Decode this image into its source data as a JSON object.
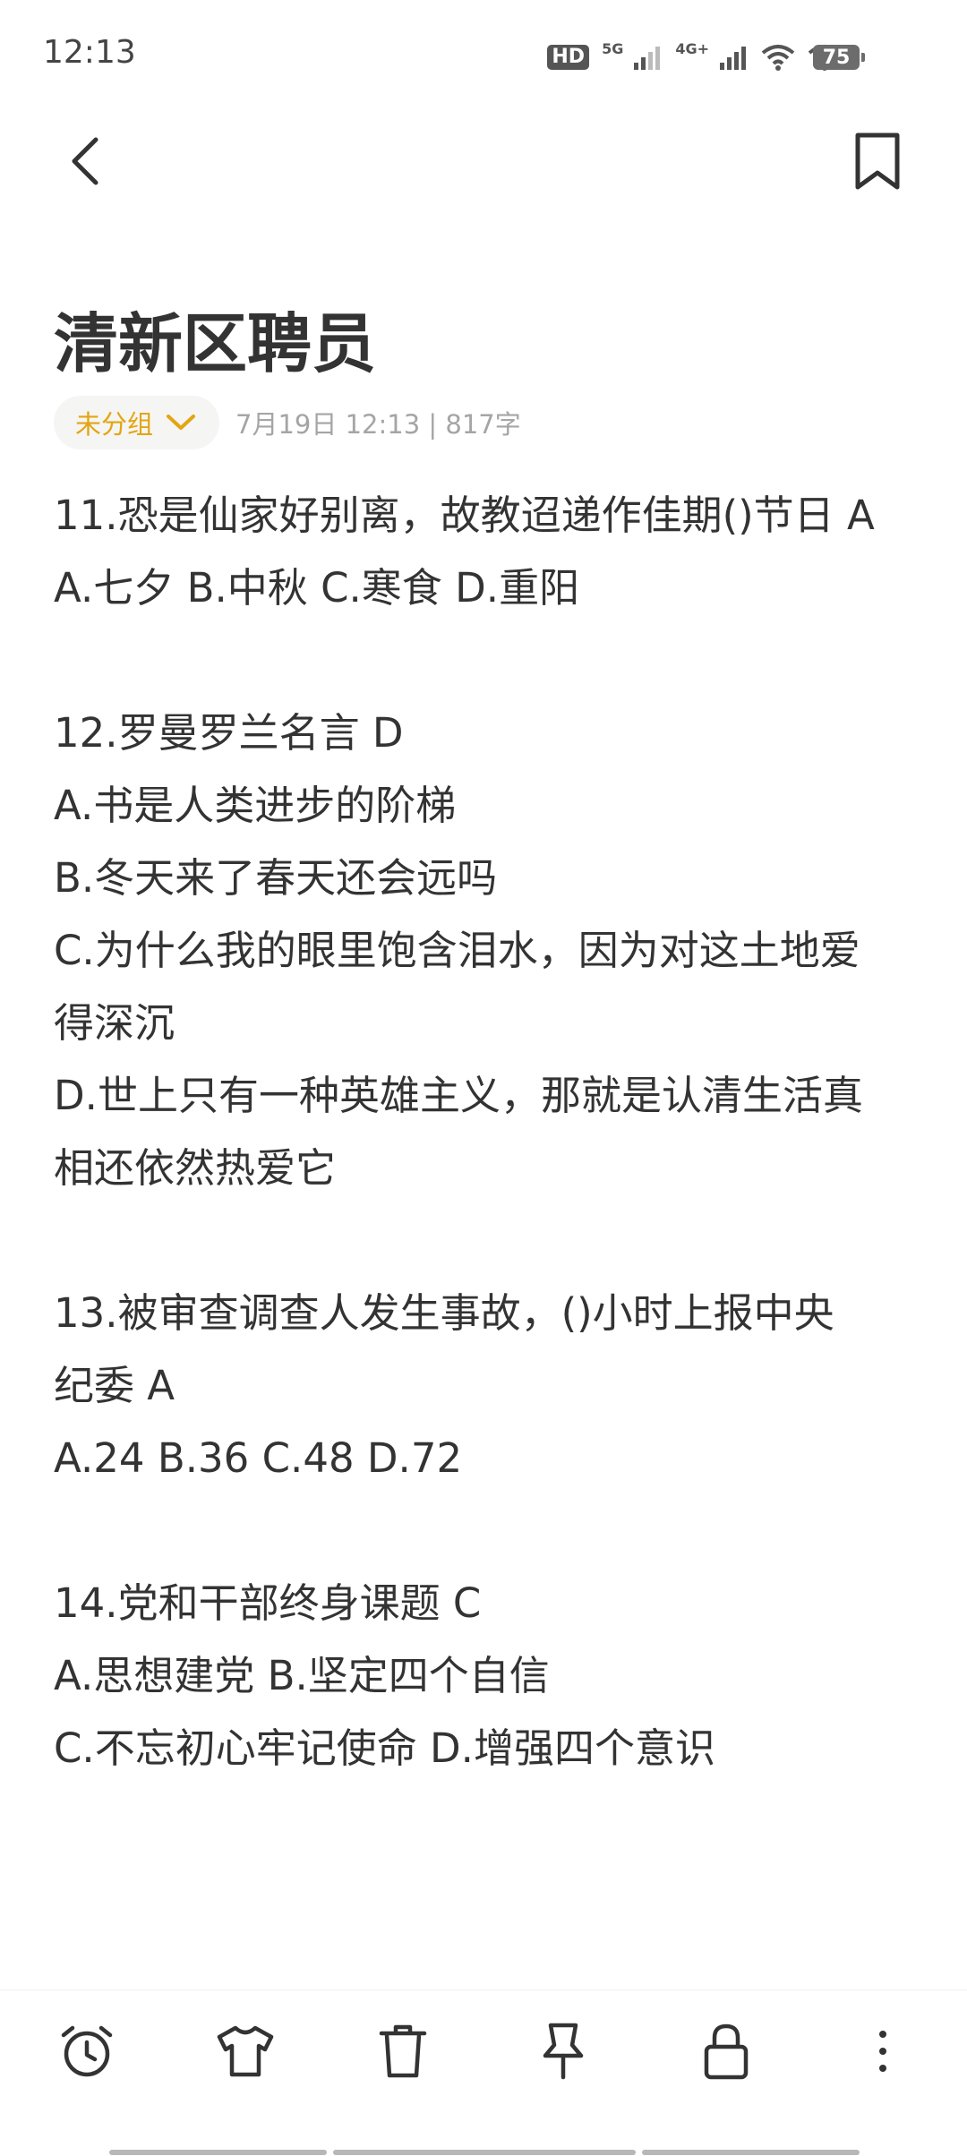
{
  "status_bar": {
    "time": "12:13",
    "hd_label": "HD",
    "net1_label": "5G",
    "net2_label": "4G+",
    "battery": "75",
    "icons": [
      "hd-icon",
      "signal-5g-icon",
      "signal-4g-icon",
      "wifi-icon",
      "wifi-icon",
      "battery-icon"
    ]
  },
  "header": {
    "back_icon": "chevron-left-icon",
    "bookmark_icon": "bookmark-icon"
  },
  "note": {
    "title": "清新区聘员",
    "group_label": "未分组",
    "group_icon": "chevron-down-icon",
    "group_color": "#e3a512",
    "meta": "7月19日 12:13  |  817字",
    "lines": [
      "11.恐是仙家好别离，故教迢递作佳期()节日 A",
      "A.七夕 B.中秋 C.寒食 D.重阳",
      "",
      "12.罗曼罗兰名言 D",
      "A.书是人类进步的阶梯",
      "B.冬天来了春天还会远吗",
      "C.为什么我的眼里饱含泪水，因为对这土地爱",
      "得深沉",
      "D.世上只有一种英雄主义，那就是认清生活真",
      "相还依然热爱它",
      "",
      "13.被审查调查人发生事故，()小时上报中央",
      "纪委 A",
      "A.24 B.36 C.48 D.72",
      "",
      "14.党和干部终身课题 C",
      "A.思想建党 B.坚定四个自信",
      "C.不忘初心牢记使命 D.增强四个意识"
    ]
  },
  "toolbar": {
    "icons": [
      "alarm-icon",
      "shirt-icon",
      "trash-icon",
      "pin-icon",
      "lock-icon",
      "more-icon"
    ]
  }
}
